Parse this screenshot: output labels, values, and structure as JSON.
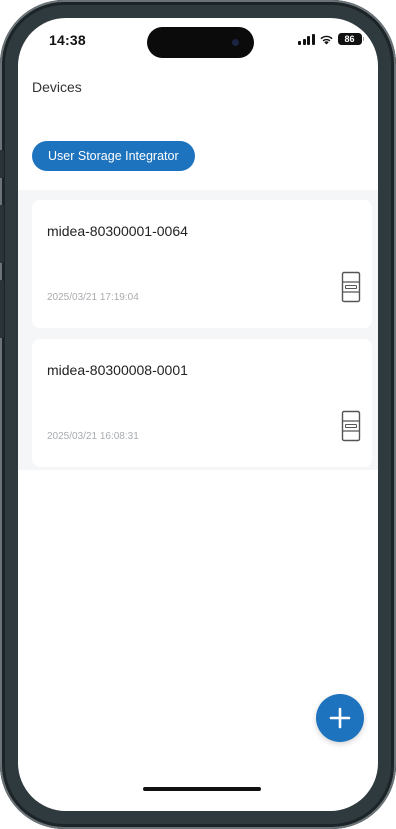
{
  "status_bar": {
    "time": "14:38",
    "battery": "86"
  },
  "header": {
    "title": "Devices"
  },
  "filter": {
    "label": "User Storage Integrator"
  },
  "devices": [
    {
      "name": "midea-80300001-0064",
      "timestamp": "2025/03/21 17:19:04",
      "icon": "storage-cabinet-icon"
    },
    {
      "name": "midea-80300008-0001",
      "timestamp": "2025/03/21 16:08:31",
      "icon": "storage-cabinet-icon"
    }
  ],
  "fab": {
    "icon": "plus-icon"
  },
  "colors": {
    "accent": "#1e73be",
    "list_background": "#f5f6f7",
    "timestamp_text": "#a8acb0"
  }
}
